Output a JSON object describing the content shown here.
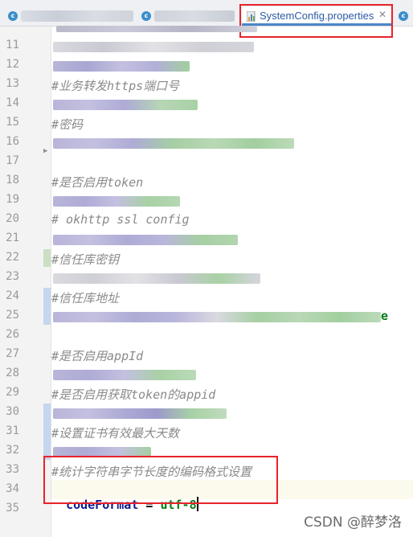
{
  "tabs": {
    "active_label": "SystemConfig.properties",
    "close_glyph": "✕"
  },
  "gutter": {
    "line_numbers": [
      "11",
      "12",
      "13",
      "14",
      "15",
      "16",
      "17",
      "18",
      "19",
      "20",
      "21",
      "22",
      "23",
      "24",
      "25",
      "26",
      "27",
      "28",
      "29",
      "30",
      "31",
      "32",
      "33",
      "34",
      "35"
    ]
  },
  "editor": {
    "comments": [
      "#业务转发https端口号",
      "#密码",
      "#是否启用token",
      "# okhttp ssl config",
      "#信任库密钥",
      "#信任库地址",
      "#是否启用appId",
      "#是否启用获取token的appid",
      "#设置证书有效最大天数",
      "#统计字符串字节长度的编码格式设置"
    ],
    "line25_tail": "e",
    "line34": {
      "key": "codeFormat",
      "eq": " = ",
      "value": "utf-8"
    }
  },
  "watermark": "CSDN @醉梦洛",
  "colors": {
    "highlight_box": "#e8232a",
    "comment": "#8a8a8a",
    "key": "#0c1f8c",
    "value": "#067d17"
  }
}
